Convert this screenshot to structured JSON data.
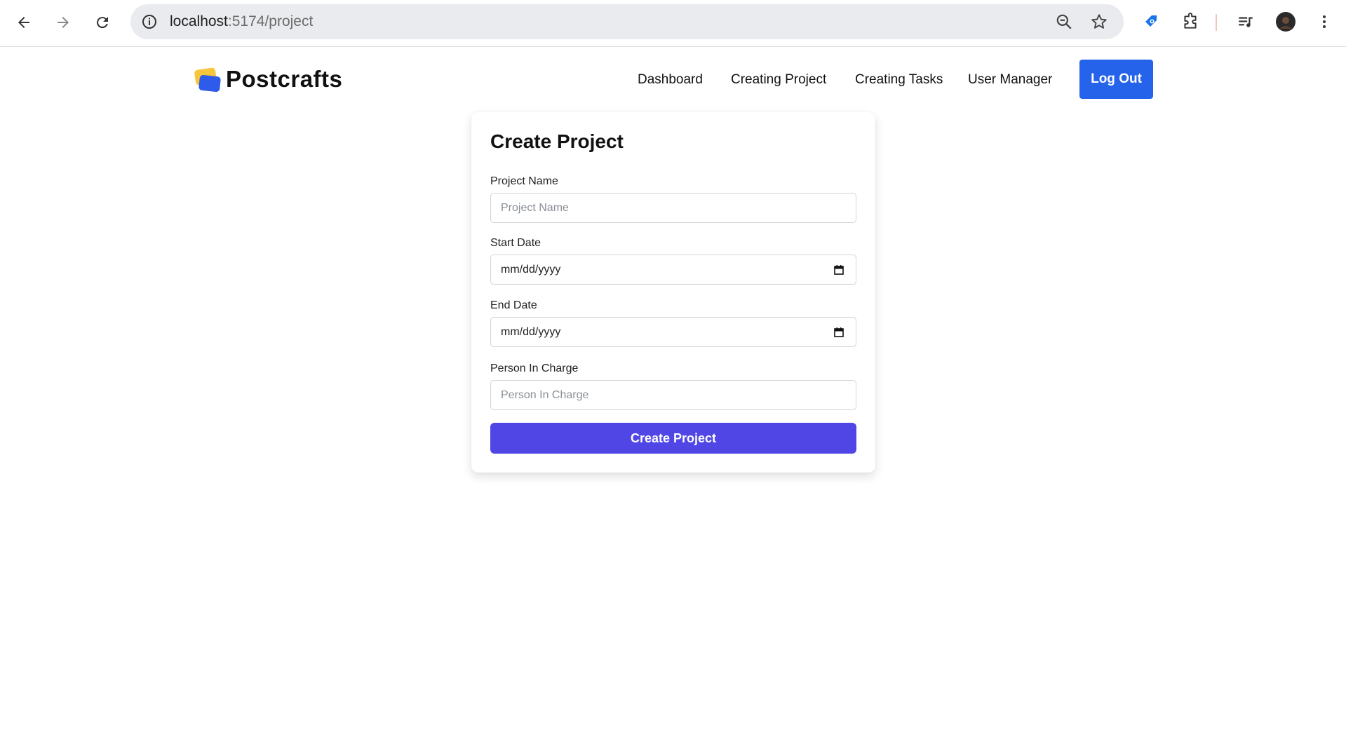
{
  "browser": {
    "url_host": "localhost",
    "url_path": ":5174/project",
    "icons": [
      "back-arrow-icon",
      "forward-arrow-icon",
      "reload-icon",
      "site-info-icon",
      "zoom-icon",
      "bookmark-star-icon",
      "extension-tag-icon",
      "puzzle-extensions-icon",
      "media-queue-icon",
      "profile-avatar",
      "kebab-menu-icon"
    ]
  },
  "header": {
    "brand": "Postcrafts",
    "nav": [
      "Dashboard",
      "Creating Project",
      "Creating Tasks",
      "User Manager"
    ],
    "logout": "Log Out",
    "colors": {
      "logout_bg": "#2563eb",
      "logo_yellow": "#f7c63b",
      "logo_blue": "#2f5bea"
    }
  },
  "form": {
    "title": "Create Project",
    "project_name_label": "Project Name",
    "project_name_placeholder": "Project Name",
    "start_date_label": "Start Date",
    "start_date_value": "mm/dd/yyyy",
    "end_date_label": "End Date",
    "end_date_value": "mm/dd/yyyy",
    "person_label": "Person In Charge",
    "person_placeholder": "Person In Charge",
    "submit": "Create Project",
    "colors": {
      "submit_bg": "#4f46e5"
    }
  }
}
